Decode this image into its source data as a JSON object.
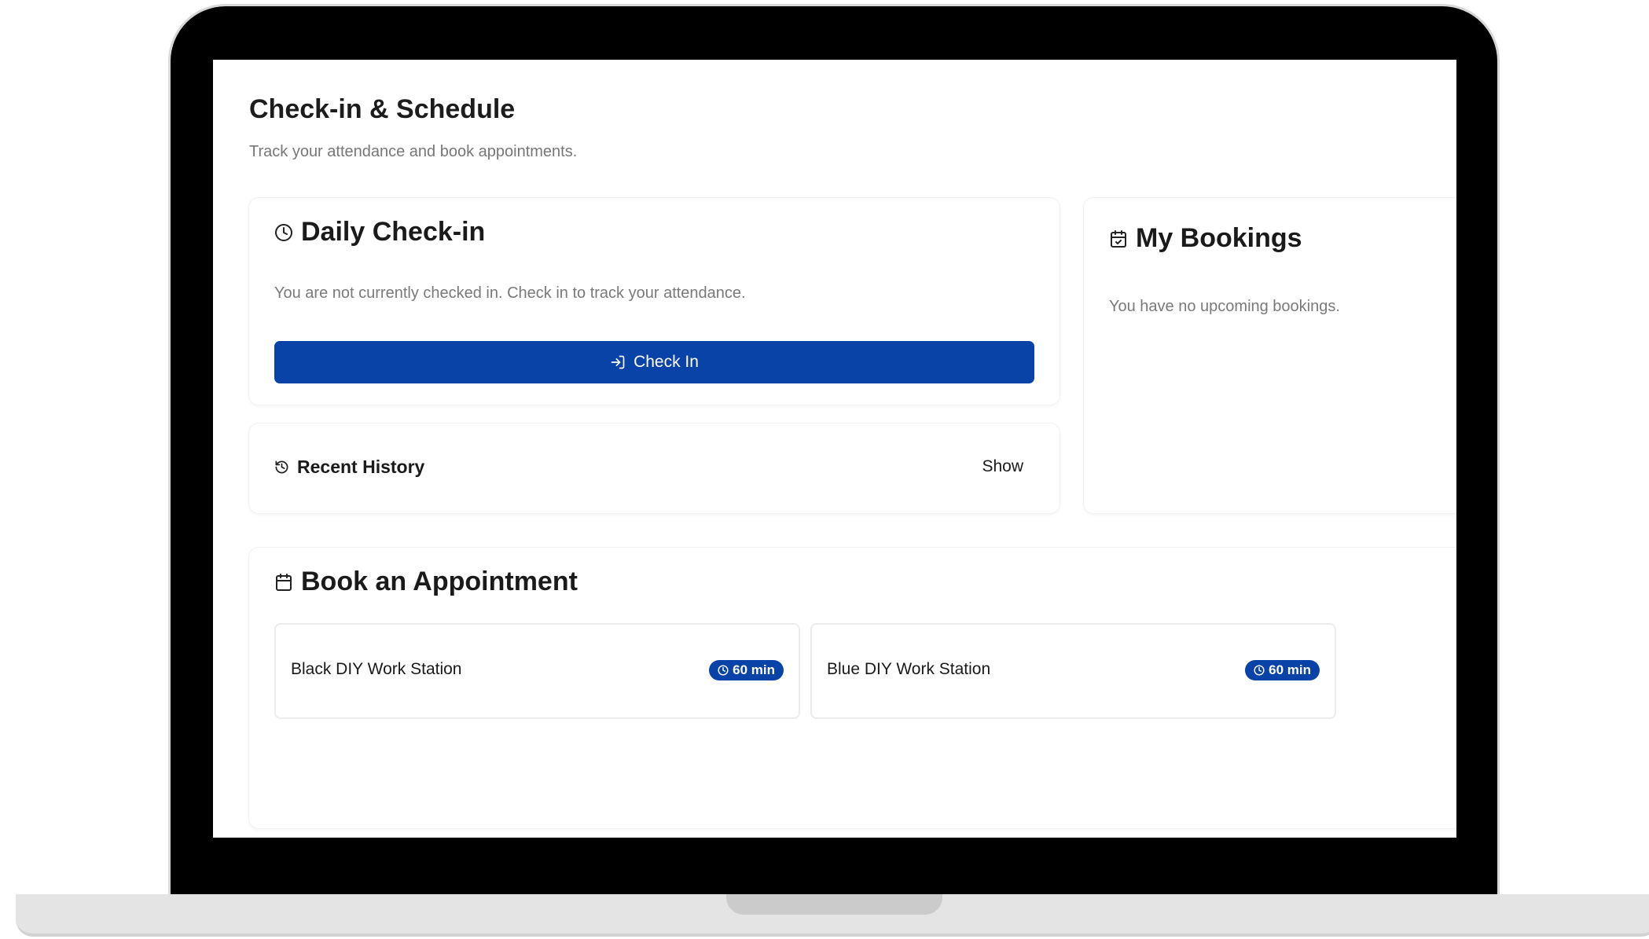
{
  "page": {
    "title": "Check-in & Schedule",
    "subtitle": "Track your attendance and book appointments."
  },
  "daily_checkin": {
    "title": "Daily Check-in",
    "icon": "clock-icon",
    "status_text": "You are not currently checked in. Check in to track your attendance.",
    "button_label": "Check In",
    "button_icon": "log-in-icon"
  },
  "recent_history": {
    "title": "Recent History",
    "icon": "history-icon",
    "toggle_label": "Show"
  },
  "my_bookings": {
    "title": "My Bookings",
    "icon": "calendar-check-icon",
    "empty_text": "You have no upcoming bookings."
  },
  "book_appointment": {
    "title": "Book an Appointment",
    "icon": "calendar-icon",
    "stations": [
      {
        "name": "Black DIY Work Station",
        "duration": "60 min"
      },
      {
        "name": "Blue DIY Work Station",
        "duration": "60 min"
      }
    ]
  },
  "colors": {
    "primary": "#0a43a8",
    "muted_text": "#7a7a7a",
    "heading_text": "#1c1c1c",
    "device_frame": "#000000"
  }
}
